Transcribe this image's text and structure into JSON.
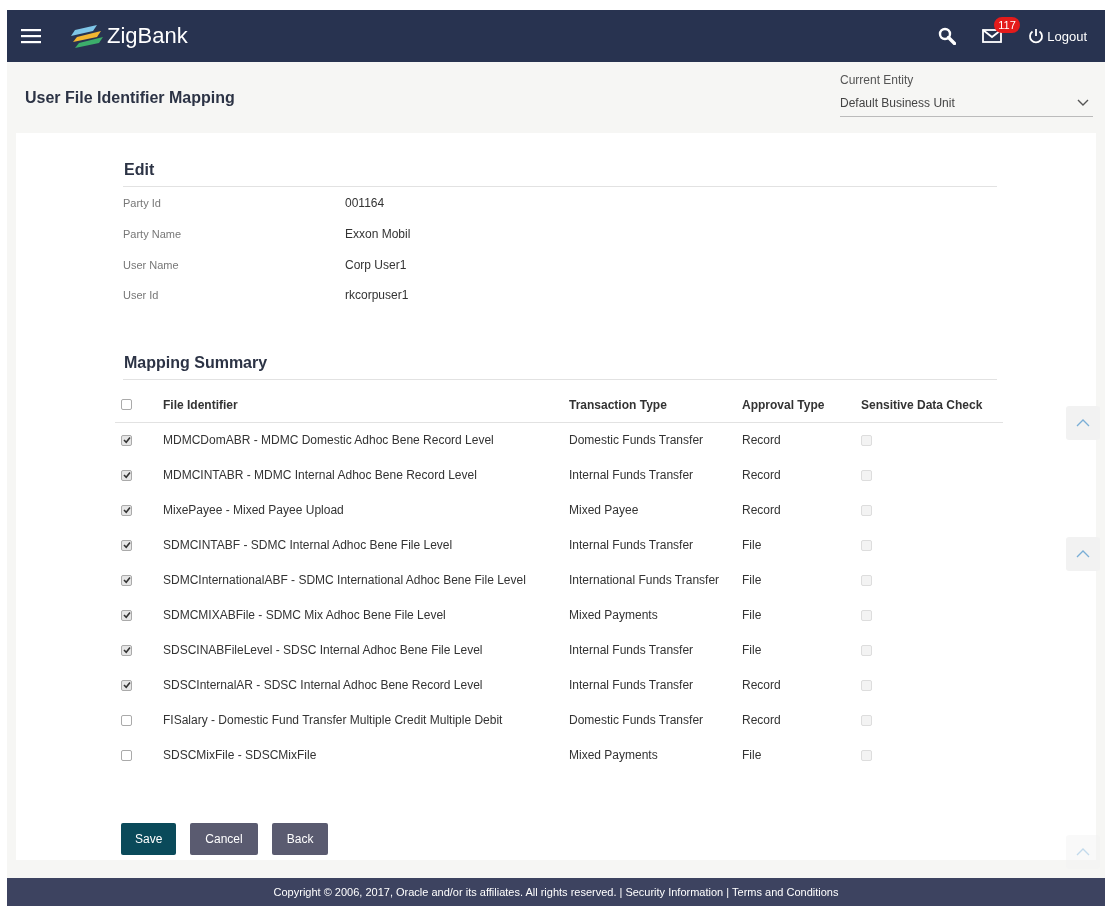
{
  "header": {
    "brand": "ZigBank",
    "notification_count": "117",
    "logout": "Logout"
  },
  "page": {
    "title": "User File Identifier Mapping",
    "entity_label": "Current Entity",
    "entity_value": "Default Business Unit"
  },
  "edit": {
    "heading": "Edit",
    "fields": [
      {
        "label": "Party Id",
        "value": "001164"
      },
      {
        "label": "Party Name",
        "value": "Exxon Mobil"
      },
      {
        "label": "User Name",
        "value": "Corp User1"
      },
      {
        "label": "User Id",
        "value": "rkcorpuser1"
      }
    ]
  },
  "mapping": {
    "heading": "Mapping Summary",
    "select_all": {
      "checked": false
    },
    "columns": [
      "File Identifier",
      "Transaction Type",
      "Approval Type",
      "Sensitive Data Check"
    ],
    "rows": [
      {
        "checked": true,
        "file_identifier": "MDMCDomABR - MDMC Domestic Adhoc Bene Record Level",
        "transaction_type": "Domestic Funds Transfer",
        "approval_type": "Record",
        "sensitive": false,
        "sensitive_disabled": true
      },
      {
        "checked": true,
        "file_identifier": "MDMCINTABR - MDMC Internal Adhoc Bene Record Level",
        "transaction_type": "Internal Funds Transfer",
        "approval_type": "Record",
        "sensitive": false,
        "sensitive_disabled": true
      },
      {
        "checked": true,
        "file_identifier": "MixePayee - Mixed Payee Upload",
        "transaction_type": "Mixed Payee",
        "approval_type": "Record",
        "sensitive": false,
        "sensitive_disabled": true
      },
      {
        "checked": true,
        "file_identifier": "SDMCINTABF - SDMC Internal Adhoc Bene File Level",
        "transaction_type": "Internal Funds Transfer",
        "approval_type": "File",
        "sensitive": false,
        "sensitive_disabled": true
      },
      {
        "checked": true,
        "file_identifier": "SDMCInternationalABF - SDMC International Adhoc Bene File Level",
        "transaction_type": "International Funds Transfer",
        "approval_type": "File",
        "sensitive": false,
        "sensitive_disabled": true
      },
      {
        "checked": true,
        "file_identifier": "SDMCMIXABFile - SDMC Mix Adhoc Bene File Level",
        "transaction_type": "Mixed Payments",
        "approval_type": "File",
        "sensitive": false,
        "sensitive_disabled": true
      },
      {
        "checked": true,
        "file_identifier": "SDSCINABFileLevel - SDSC Internal Adhoc Bene File Level",
        "transaction_type": "Internal Funds Transfer",
        "approval_type": "File",
        "sensitive": false,
        "sensitive_disabled": true
      },
      {
        "checked": true,
        "file_identifier": "SDSCInternalAR - SDSC Internal Adhoc Bene Record Level",
        "transaction_type": "Internal Funds Transfer",
        "approval_type": "Record",
        "sensitive": false,
        "sensitive_disabled": true
      },
      {
        "checked": false,
        "file_identifier": "FISalary - Domestic Fund Transfer Multiple Credit Multiple Debit",
        "transaction_type": "Domestic Funds Transfer",
        "approval_type": "Record",
        "sensitive": false,
        "sensitive_disabled": true
      },
      {
        "checked": false,
        "file_identifier": "SDSCMixFile - SDSCMixFile",
        "transaction_type": "Mixed Payments",
        "approval_type": "File",
        "sensitive": false,
        "sensitive_disabled": true
      }
    ]
  },
  "buttons": [
    {
      "label": "Save",
      "kind": "primary"
    },
    {
      "label": "Cancel",
      "kind": "secondary"
    },
    {
      "label": "Back",
      "kind": "secondary"
    }
  ],
  "footer": {
    "copyright": "Copyright © 2006, 2017, Oracle and/or its affiliates. All rights reserved.",
    "separator_1": "|",
    "link_1": "Security Information",
    "separator_2": "|",
    "link_2": "Terms and Conditions"
  }
}
